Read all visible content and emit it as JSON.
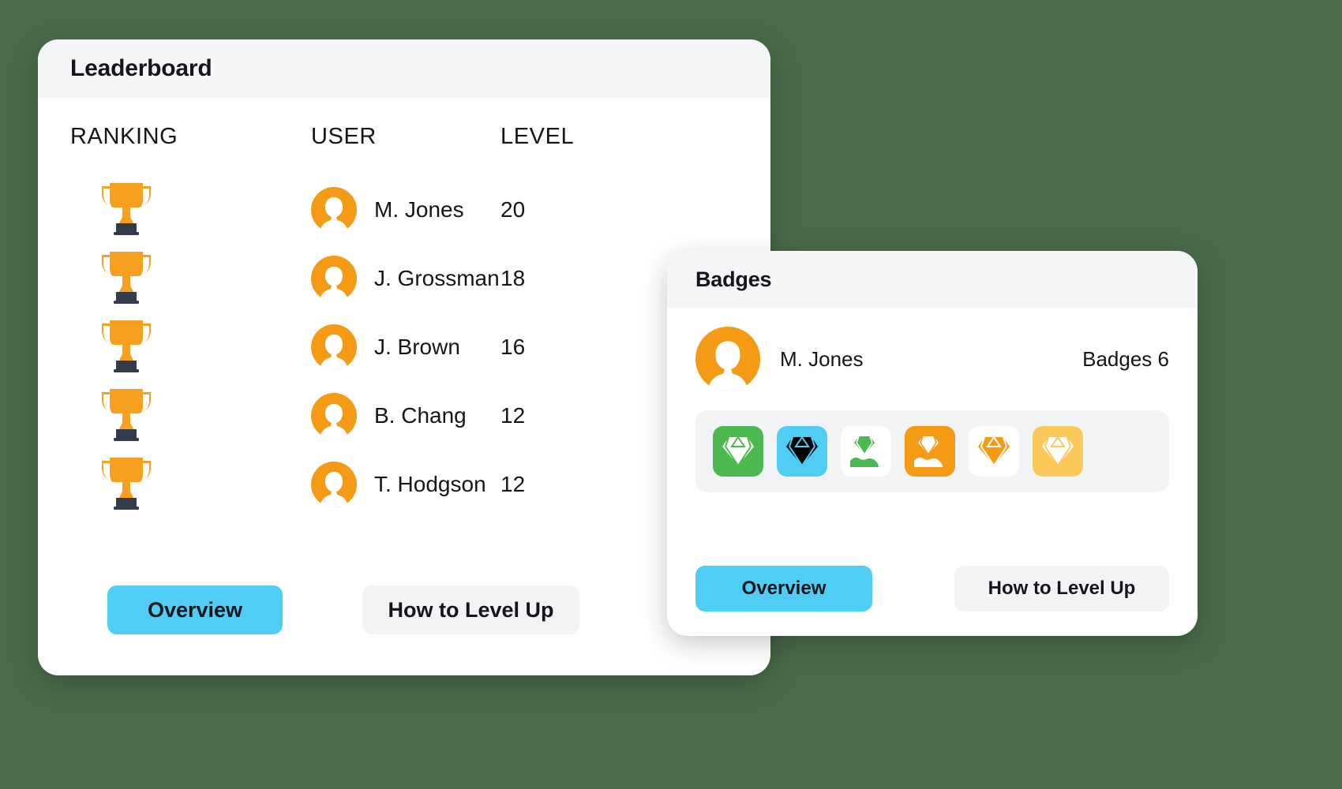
{
  "theme": {
    "background": "#4a6b4a",
    "card_bg": "#ffffff",
    "header_bg": "#f4f5f7",
    "accent_cyan": "#4fcdf4",
    "accent_orange": "#f49a15",
    "ghost_bg": "#f2f3f5",
    "text": "#14161a",
    "trophy_cup": "#f79f1f",
    "trophy_base": "#343b4c"
  },
  "leaderboard": {
    "title": "Leaderboard",
    "columns": {
      "ranking": "RANKING",
      "user": "USER",
      "level": "LEVEL"
    },
    "rows": [
      {
        "rank_icon": "trophy-icon",
        "avatar": "avatar-female-icon",
        "user": "M. Jones",
        "level": "20"
      },
      {
        "rank_icon": "trophy-icon",
        "avatar": "avatar-male-icon",
        "user": "J. Grossman",
        "level": "18"
      },
      {
        "rank_icon": "trophy-icon",
        "avatar": "avatar-female-icon",
        "user": "J. Brown",
        "level": "16"
      },
      {
        "rank_icon": "trophy-icon",
        "avatar": "avatar-male-icon",
        "user": "B. Chang",
        "level": "12"
      },
      {
        "rank_icon": "trophy-icon",
        "avatar": "avatar-female-icon",
        "user": "T. Hodgson",
        "level": "12"
      }
    ],
    "buttons": {
      "overview": "Overview",
      "level_up": "How to Level Up"
    }
  },
  "badges": {
    "title": "Badges",
    "user": {
      "avatar": "avatar-female-icon",
      "name": "M. Jones",
      "count_label": "Badges 6"
    },
    "items": [
      {
        "name": "badge-diamond-green",
        "icon": "diamond-icon",
        "tile_bg": "#4cb850",
        "glyph_color": "#ffffff"
      },
      {
        "name": "badge-diamond-cyan",
        "icon": "diamond-icon",
        "tile_bg": "#4fcdf4",
        "glyph_color": "#000000"
      },
      {
        "name": "badge-diamond-hand-green",
        "icon": "diamond-in-hand-icon",
        "tile_bg": "#ffffff",
        "glyph_color": "#4cb850"
      },
      {
        "name": "badge-diamond-hand-orange",
        "icon": "diamond-in-hand-icon",
        "tile_bg": "#f49a15",
        "glyph_color": "#ffffff"
      },
      {
        "name": "badge-diamond-white",
        "icon": "diamond-icon",
        "tile_bg": "#ffffff",
        "glyph_color": "#f49a15"
      },
      {
        "name": "badge-diamond-yellow",
        "icon": "diamond-icon",
        "tile_bg": "#fbc85a",
        "glyph_color": "#ffffff"
      }
    ],
    "buttons": {
      "overview": "Overview",
      "level_up": "How to Level Up"
    }
  }
}
